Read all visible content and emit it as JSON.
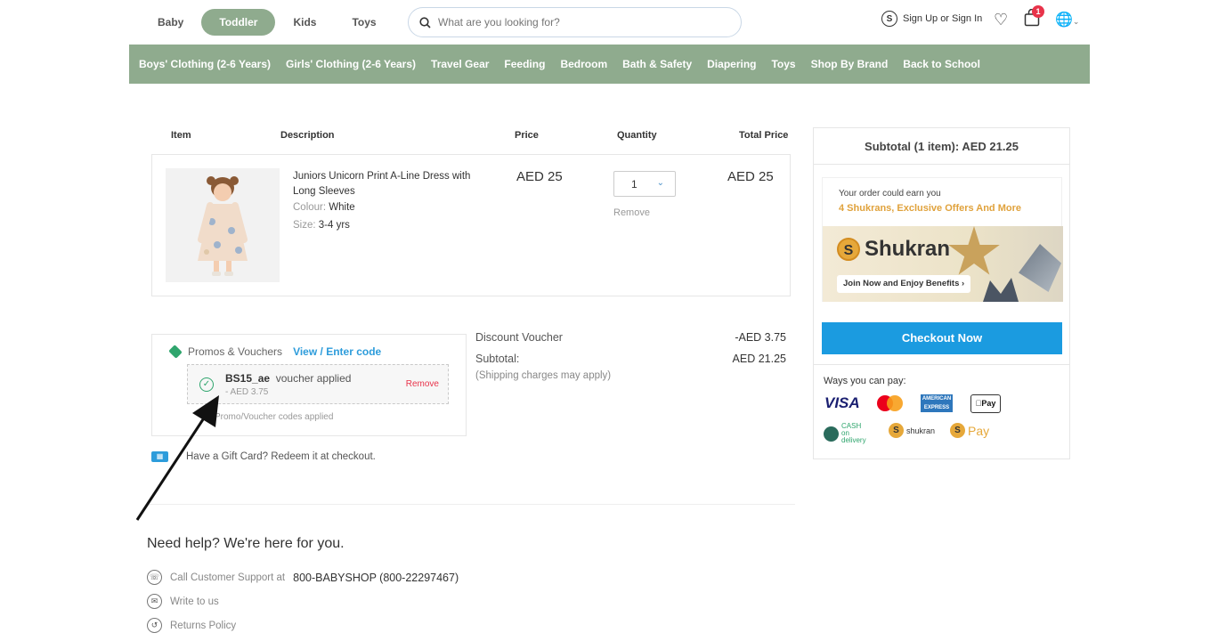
{
  "topbar": {
    "segments": [
      "Baby",
      "Toddler",
      "Kids",
      "Toys"
    ],
    "active_segment": "Toddler",
    "search_placeholder": "What are you looking for?",
    "account_label": "Sign Up or Sign In",
    "cart_count": "1"
  },
  "nav": {
    "items": [
      "Boys' Clothing (2-6 Years)",
      "Girls' Clothing (2-6 Years)",
      "Travel Gear",
      "Feeding",
      "Bedroom",
      "Bath & Safety",
      "Diapering",
      "Toys",
      "Shop By Brand",
      "Back to School"
    ]
  },
  "cart": {
    "headers": {
      "item": "Item",
      "description": "Description",
      "price": "Price",
      "quantity": "Quantity",
      "total": "Total Price"
    },
    "product": {
      "name": "Juniors Unicorn Print A-Line Dress with Long Sleeves",
      "colour_label": "Colour:",
      "colour_value": "White",
      "size_label": "Size:",
      "size_value": "3-4 yrs",
      "price": "AED 25",
      "quantity": "1",
      "total": "AED 25",
      "remove_label": "Remove"
    }
  },
  "promo": {
    "title": "Promos & Vouchers",
    "link": "View / Enter code",
    "voucher_code": "BS15_ae",
    "voucher_status": "voucher applied",
    "voucher_amount": "- AED 3.75",
    "voucher_remove": "Remove",
    "note": "Promo/Voucher codes applied",
    "gift_icon": "gift-icon",
    "gift_text": "Have a Gift Card? Redeem it at checkout."
  },
  "summary": {
    "discount_label": "Discount Voucher",
    "discount_value": "-AED 3.75",
    "subtotal_label": "Subtotal:",
    "subtotal_value": "AED 21.25",
    "shipping_note": "(Shipping charges may apply)"
  },
  "help": {
    "title": "Need help? We're here for you.",
    "support_label": "Call Customer Support at",
    "support_number": "800-BABYSHOP (800-22297467)",
    "write_label": "Write to us",
    "returns_label": "Returns Policy"
  },
  "panel": {
    "subtotal_head": "Subtotal (1 item):  AED 21.25",
    "earn_text": "Your order could earn you",
    "earn_link": "4 Shukrans, Exclusive Offers And More",
    "shukran_brand": "Shukran",
    "join_label": "Join Now and Enjoy Benefits",
    "checkout_label": "Checkout Now",
    "pay_title": "Ways you can pay:",
    "pay_visa": "VISA",
    "pay_amex": "AMERICAN EXPRESS",
    "pay_apple": "Pay",
    "pay_cod": "CASH on delivery",
    "pay_shukran": "shukran",
    "pay_spay": "Pay"
  },
  "colors": {
    "accent_green": "#8fab8e",
    "checkout_blue": "#1b9be0",
    "remove_red": "#e8334a",
    "shukran_gold": "#e0a23c"
  }
}
